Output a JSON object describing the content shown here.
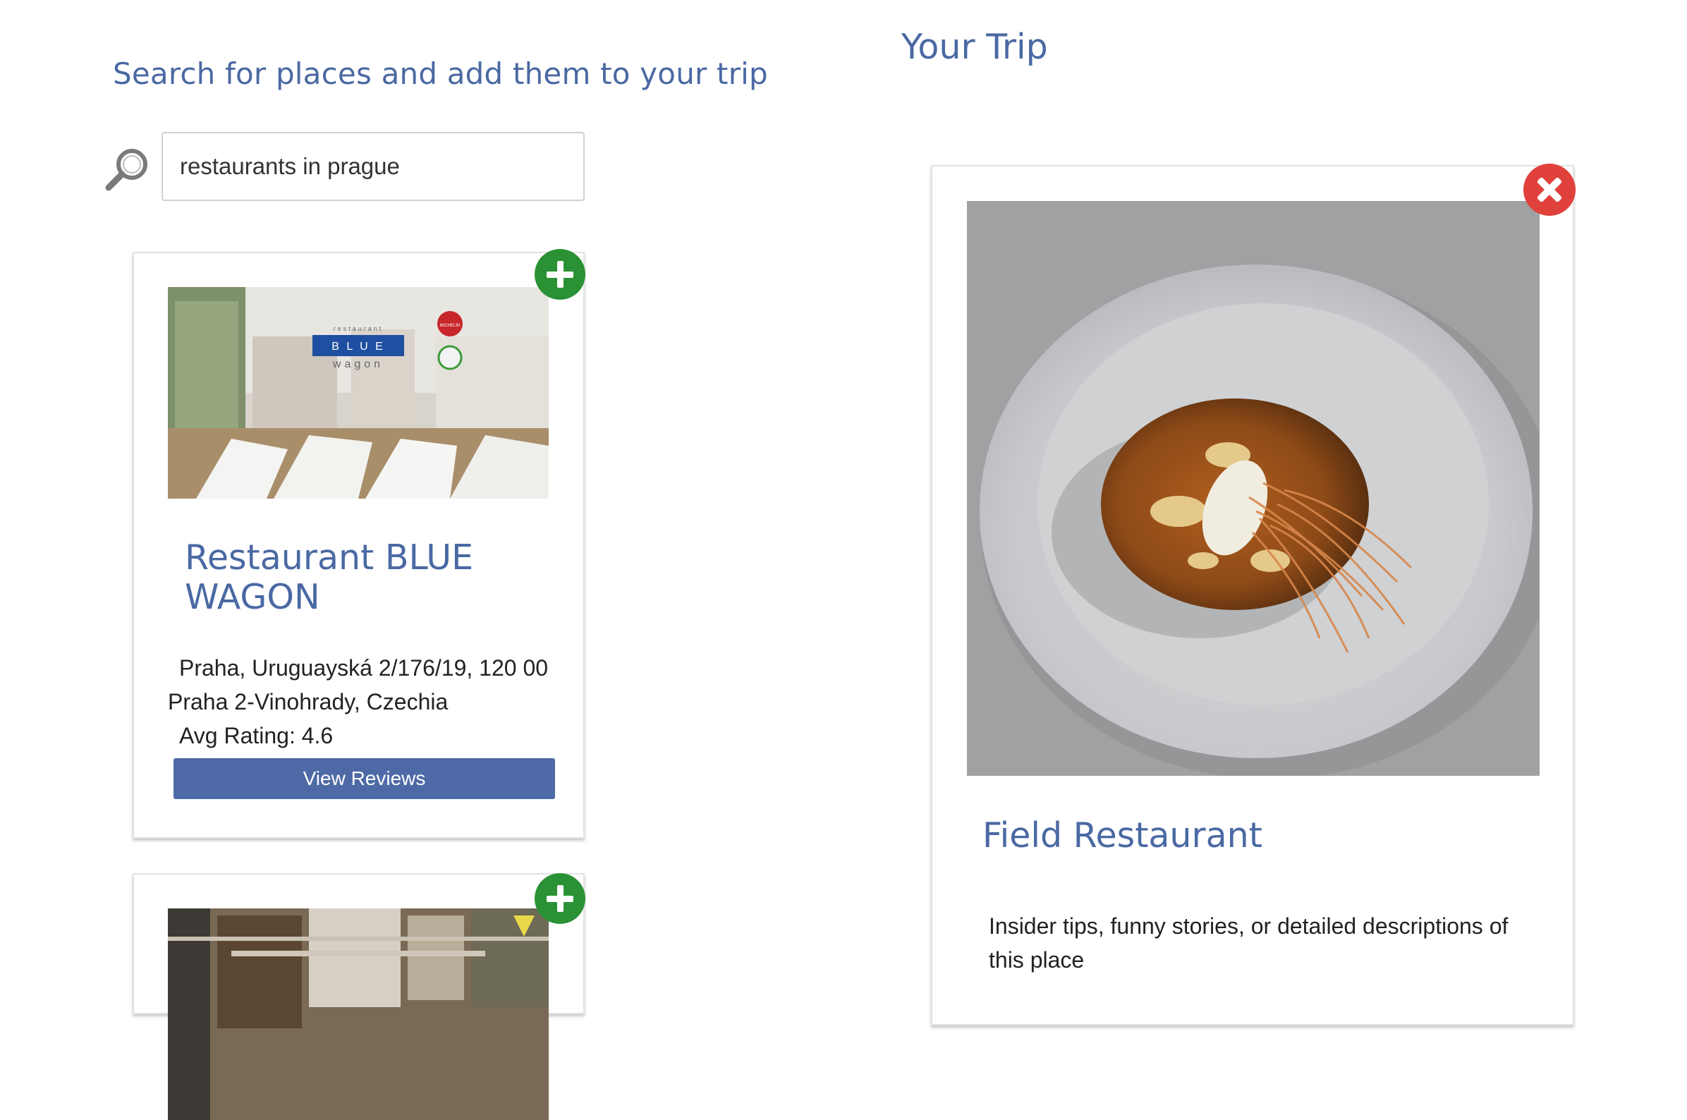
{
  "search": {
    "heading": "Search for places and add them to your trip",
    "input_value": "restaurants in prague",
    "icon": "search-icon"
  },
  "trip": {
    "heading": "Your Trip",
    "items": [
      {
        "name": "Field Restaurant",
        "description": "Insider tips, funny stories, or detailed descriptions of this place",
        "remove_icon": "close-icon"
      }
    ]
  },
  "results": [
    {
      "name": "Restaurant BLUE WAGON",
      "address_line_1": "Praha, Uruguayská 2/176/19, 120 00",
      "address_line_2": "Praha 2-Vinohrady, Czechia",
      "rating_label": "Avg Rating:",
      "rating_value": "4.6",
      "button_label": "View Reviews",
      "add_icon": "plus-icon",
      "image_sign": {
        "top": "restaurant",
        "main": "B L U E",
        "bottom": "wagon",
        "badge": "MICHELIN"
      }
    },
    {
      "add_icon": "plus-icon"
    }
  ],
  "colors": {
    "heading": "#4a69a3",
    "add_button": "#2a9135",
    "remove_button": "#e0413b",
    "view_reviews_button": "#4e6aa6"
  }
}
